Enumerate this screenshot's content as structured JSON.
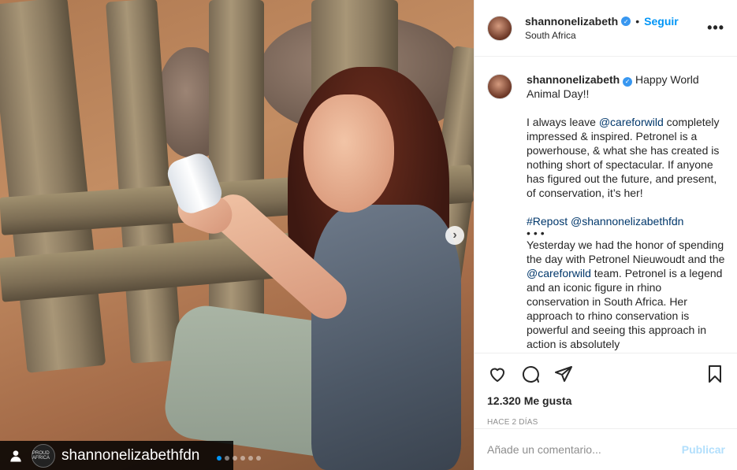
{
  "post": {
    "username": "shannonelizabeth",
    "follow_label": "Seguir",
    "location": "South Africa",
    "separator": "•",
    "more_label": "•••",
    "verified_mark": "✓"
  },
  "caption": {
    "username": "shannonelizabeth",
    "intro": "Happy World Animal Day!!",
    "p1_a": "I always leave ",
    "p1_mention": "@careforwild",
    "p1_b": " completely impressed & inspired. Petronel is a powerhouse, & what she has created is nothing short of spectacular. If anyone has figured out the future, and present, of conservation, it’s her!",
    "repost": "#Repost @shannonelizabethfdn",
    "dots": "•••",
    "p2_a": "Yesterday we had the honor of spending the day with Petronel Nieuwoudt and the ",
    "p2_mention": "@careforwild",
    "p2_b": " team. Petronel is a legend and an iconic figure in rhino conservation in South Africa. Her approach to rhino conservation is powerful and seeing this approach in action is absolutely"
  },
  "photo": {
    "tag_name": "shannonelizabethfdn",
    "tag_avatar_text": "PROUD AFRICA",
    "carousel_count": 6,
    "carousel_active": 0
  },
  "stats": {
    "likes": "12.320 Me gusta",
    "time": "HACE 2 DÍAS"
  },
  "comment": {
    "placeholder": "Añade un comentario...",
    "publish_label": "Publicar"
  },
  "colors": {
    "link": "#0095f6",
    "mention": "#00376b",
    "verified": "#3897f0",
    "publish_disabled": "#b2dffc"
  },
  "icons": {
    "like": "heart-icon",
    "comment": "comment-icon",
    "share": "paper-plane-icon",
    "save": "bookmark-icon",
    "next": "chevron-right-icon",
    "tag": "person-tag-icon",
    "more": "more-options-icon"
  }
}
